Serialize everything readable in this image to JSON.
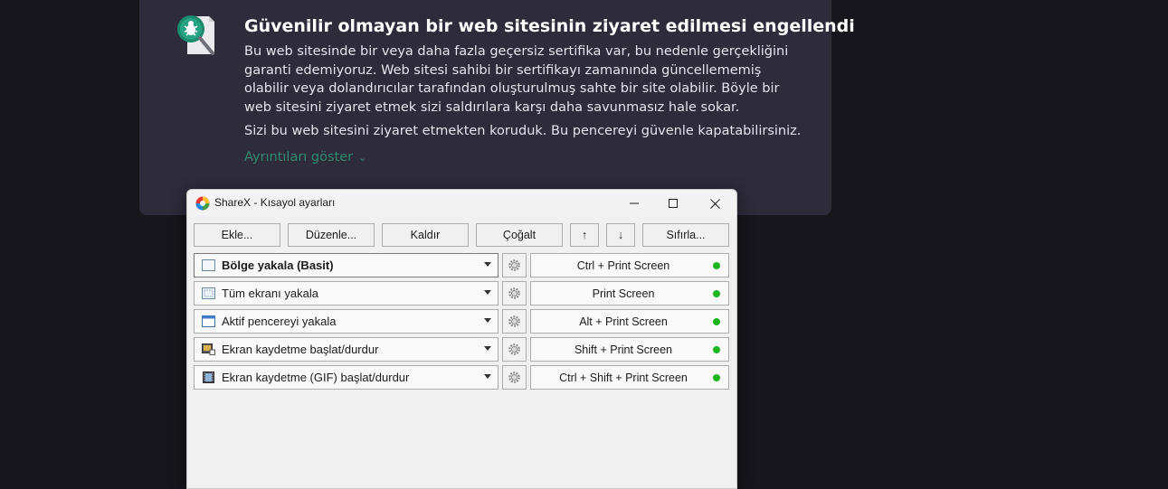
{
  "warning": {
    "title": "Güvenilir olmayan bir web sitesinin ziyaret edilmesi engellendi",
    "body": "Bu web sitesinde bir veya daha fazla geçersiz sertifika var, bu nedenle gerçekliğini garanti edemiyoruz. Web sitesi sahibi bir sertifikayı zamanında güncellememiş olabilir veya dolandırıcılar tarafından oluşturulmuş sahte bir site olabilir. Böyle bir web sitesini ziyaret etmek sizi saldırılara karşı daha savunmasız hale sokar.",
    "body2": "Sizi bu web sitesini ziyaret etmekten koruduk. Bu pencereyi güvenle kapatabilirsiniz.",
    "details_link": "Ayrıntıları göster",
    "icon": "shield-bug-magnifier-icon",
    "accent_color": "#2f8a6e"
  },
  "window": {
    "title": "ShareX - Kısayol ayarları",
    "app_icon": "sharex-icon",
    "minimize_icon": "minimize-icon",
    "maximize_icon": "maximize-icon",
    "close_icon": "close-icon"
  },
  "toolbar": {
    "add": "Ekle...",
    "edit": "Düzenle...",
    "remove": "Kaldır",
    "duplicate": "Çoğalt",
    "up": "↑",
    "down": "↓",
    "reset": "Sıfırla..."
  },
  "hotkeys": [
    {
      "task": "Bölge yakala (Basit)",
      "icon": "region-capture-icon",
      "hotkey": "Ctrl + Print Screen",
      "status_color": "#1eb61e"
    },
    {
      "task": "Tüm ekranı yakala",
      "icon": "fullscreen-capture-icon",
      "hotkey": "Print Screen",
      "status_color": "#1eb61e"
    },
    {
      "task": "Aktif pencereyi yakala",
      "icon": "window-capture-icon",
      "hotkey": "Alt + Print Screen",
      "status_color": "#1eb61e"
    },
    {
      "task": "Ekran kaydetme başlat/durdur",
      "icon": "screen-record-icon",
      "hotkey": "Shift + Print Screen",
      "status_color": "#1eb61e"
    },
    {
      "task": "Ekran kaydetme (GIF) başlat/durdur",
      "icon": "gif-record-icon",
      "hotkey": "Ctrl + Shift + Print Screen",
      "status_color": "#1eb61e"
    }
  ]
}
